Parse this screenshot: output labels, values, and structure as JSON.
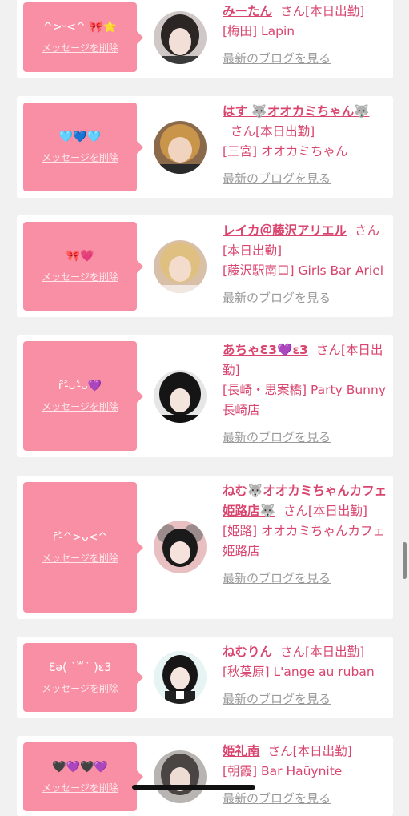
{
  "san_label": "さん",
  "delete_label": "メッセージを削除",
  "blog_label": "最新のブログを見る",
  "cards": [
    {
      "message": "^>ᵕ<^ 🎀⭐️",
      "name": "みーたん",
      "status": "[本日出勤]",
      "shop": "[梅田] Lapin"
    },
    {
      "message": "🩵💙🩵",
      "name": "はす 🐺オオカミちゃん🐺",
      "status": "[本日出勤]",
      "shop": "[三宮] オオカミちゃん"
    },
    {
      "message": "🎀💗",
      "name": "レイカ＠藤沢アリエル",
      "status": "[本日出勤]",
      "shop": "[藤沢駅南口] Girls Bar Ariel"
    },
    {
      "message": "ȓ˃̵ᴗ˂̵ᴗ💜",
      "name": "あちゃƐ3💜ɛ3",
      "status": "[本日出勤]",
      "shop": "[長崎・思案橋] Party Bunny 長崎店"
    },
    {
      "message": "ȓ˃̵^>ᴗ<^",
      "name": "ねむ🐺オオカミちゃんカフェ姫路店🐺",
      "status": "[本日出勤]",
      "shop": "[姫路] オオカミちゃんカフェ姫路店"
    },
    {
      "message": "Ɛə( ˙꒳˙ )ɛ3",
      "name": "ねむりん",
      "status": "[本日出勤]",
      "shop": "[秋葉原] L'ange au ruban"
    },
    {
      "message": "🖤💜🖤💜",
      "name": "姫礼南",
      "status": "[本日出勤]",
      "shop": "[朝霞] Bar Haüynite"
    }
  ]
}
